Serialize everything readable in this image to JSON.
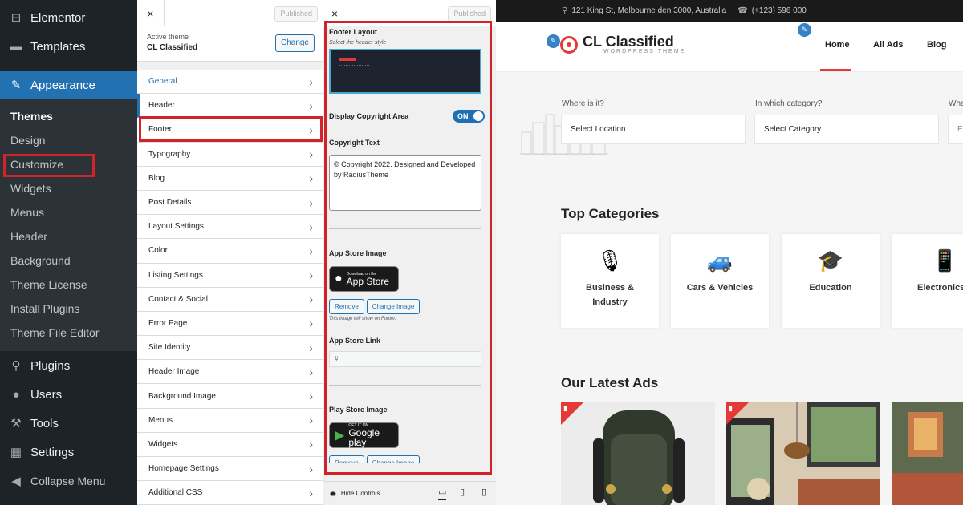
{
  "wp_menu": {
    "items_top": [
      {
        "label": "Elementor",
        "icon": "elementor-icon",
        "glyph": "⊟"
      },
      {
        "label": "Templates",
        "icon": "folder-icon",
        "glyph": "▬"
      }
    ],
    "appearance": {
      "label": "Appearance",
      "icon": "paintbrush-icon",
      "glyph": "✎"
    },
    "submenu": [
      "Themes",
      "Design",
      "Customize",
      "Widgets",
      "Menus",
      "Header",
      "Background",
      "Theme License",
      "Install Plugins",
      "Theme File Editor"
    ],
    "items_bottom": [
      {
        "label": "Plugins",
        "icon": "plugin-icon",
        "glyph": "⚲"
      },
      {
        "label": "Users",
        "icon": "users-icon",
        "glyph": "●"
      },
      {
        "label": "Tools",
        "icon": "tools-icon",
        "glyph": "⚒"
      },
      {
        "label": "Settings",
        "icon": "settings-icon",
        "glyph": "▦"
      },
      {
        "label": "Collapse Menu",
        "icon": "collapse-icon",
        "glyph": "◀"
      }
    ]
  },
  "customizer": {
    "close": "×",
    "published": "Published",
    "active_theme_label": "Active theme",
    "active_theme": "CL Classified",
    "change": "Change",
    "sections": [
      "General",
      "Header",
      "Footer",
      "Typography",
      "Blog",
      "Post Details",
      "Layout Settings",
      "Color",
      "Listing Settings",
      "Contact & Social",
      "Error Page",
      "Site Identity",
      "Header Image",
      "Background Image",
      "Menus",
      "Widgets",
      "Homepage Settings",
      "Additional CSS"
    ],
    "chevron": "›"
  },
  "footer_panel": {
    "close": "×",
    "published": "Published",
    "layout_label": "Footer Layout",
    "layout_hint": "Select the header style",
    "copyright_area_label": "Display Copyright Area",
    "toggle": "ON",
    "copyright_text_label": "Copyright Text",
    "copyright_text": "© Copyright 2022. Designed and Developed by RadiusTheme",
    "app_store_image_label": "App Store Image",
    "app_store_small": "Download on the",
    "app_store_big": "App Store",
    "remove": "Remove",
    "change_image": "Change Image",
    "image_help": "This image will show on Footer.",
    "app_store_link_label": "App Store Link",
    "app_store_link": "#",
    "play_store_image_label": "Play Store Image",
    "play_small": "GET IT ON",
    "play_big": "Google play",
    "hide_controls": "Hide Controls"
  },
  "preview": {
    "address": "121 King St, Melbourne den 3000, Australia",
    "phone": "(+123) 596 000",
    "logo_name": "CL Classified",
    "logo_tagline": "WORDPRESS THEME",
    "nav": [
      "Home",
      "All Ads",
      "Blog"
    ],
    "search_labels": [
      "Where is it?",
      "In which category?",
      "Wha"
    ],
    "search_values": [
      "Select Location",
      "Select Category",
      "E"
    ],
    "top_categories": "Top Categories",
    "categories": [
      {
        "label": "Business & Industry",
        "glyph": "🎙"
      },
      {
        "label": "Cars & Vehicles",
        "glyph": "🚙"
      },
      {
        "label": "Education",
        "glyph": "🎓"
      },
      {
        "label": "Electronics",
        "glyph": "📱"
      }
    ],
    "latest_ads": "Our Latest Ads",
    "accent": "#e53935"
  }
}
